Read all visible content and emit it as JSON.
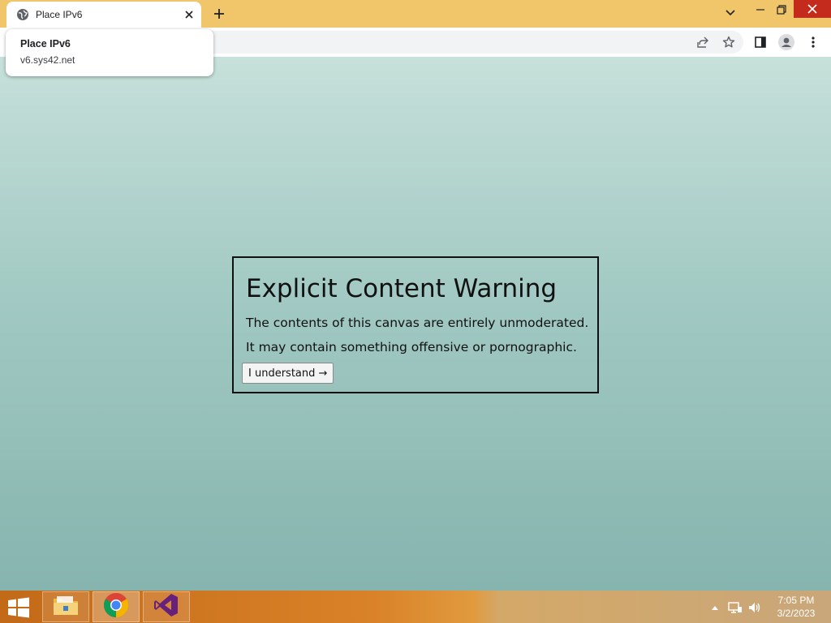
{
  "browser": {
    "tab": {
      "title": "Place IPv6"
    },
    "hover_card": {
      "title": "Place IPv6",
      "url": "v6.sys42.net"
    }
  },
  "dialog": {
    "title": "Explicit Content Warning",
    "line1": "The contents of this canvas are entirely unmoderated.",
    "line2": "It may contain something offensive or pornographic.",
    "button_label": "I understand →"
  },
  "taskbar": {
    "apps": [
      "File Explorer",
      "Google Chrome",
      "Visual Studio"
    ],
    "time": "7:05 PM",
    "date": "3/2/2023"
  },
  "colors": {
    "tab_strip": "#f1c56a",
    "close_button": "#c42b1c",
    "content_top": "#c7e0da",
    "content_bottom": "#86b4ae"
  }
}
